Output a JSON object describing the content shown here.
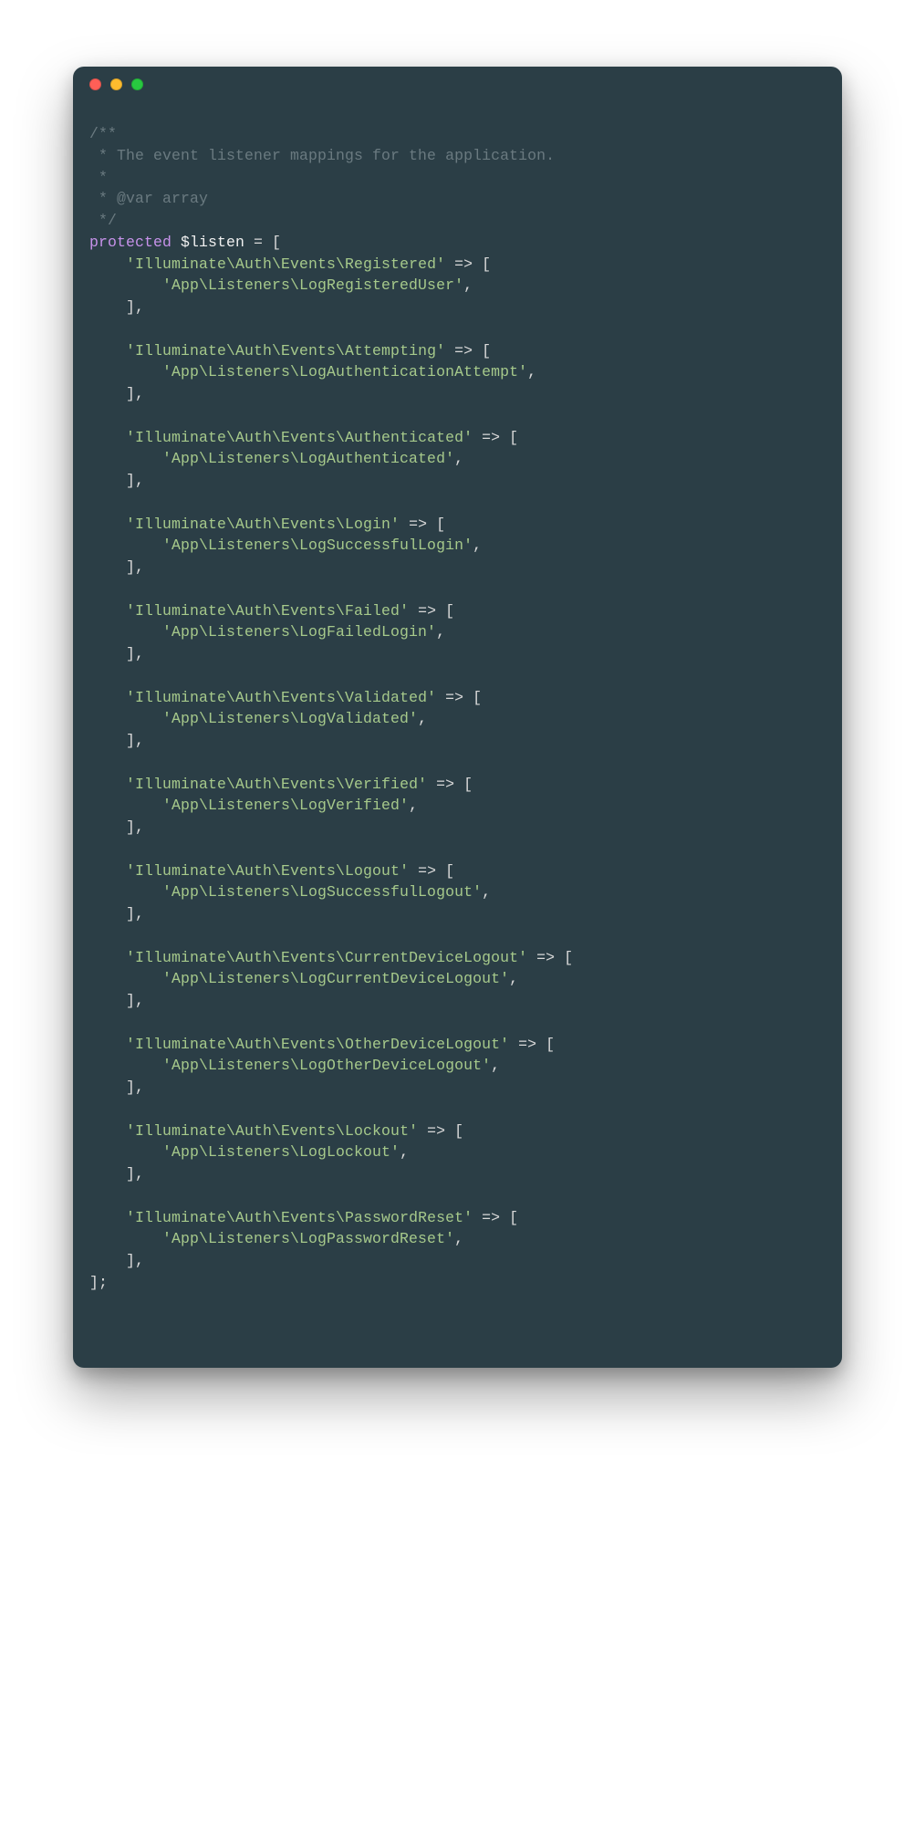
{
  "colors": {
    "window_bg": "#2b3e46",
    "comment": "#6a7a80",
    "keyword": "#c792ea",
    "variable": "#f0f0f0",
    "string": "#a6c98b",
    "punct": "#d9d9d9",
    "traffic_red": "#ff5f57",
    "traffic_yellow": "#febc2e",
    "traffic_green": "#28c840"
  },
  "doc": {
    "open": "/**",
    "line1": " * The event listener mappings for the application.",
    "blank": " *",
    "var": " * @var array",
    "close": " */"
  },
  "decl": {
    "keyword": "protected",
    "variable": "$listen",
    "assign": " = [",
    "close": "];"
  },
  "entry_punc": {
    "arrow_open": " => [",
    "listener_trail": ",",
    "block_close": "],"
  },
  "entries": [
    {
      "event": "'Illuminate\\Auth\\Events\\Registered'",
      "listener": "'App\\Listeners\\LogRegisteredUser'"
    },
    {
      "event": "'Illuminate\\Auth\\Events\\Attempting'",
      "listener": "'App\\Listeners\\LogAuthenticationAttempt'"
    },
    {
      "event": "'Illuminate\\Auth\\Events\\Authenticated'",
      "listener": "'App\\Listeners\\LogAuthenticated'"
    },
    {
      "event": "'Illuminate\\Auth\\Events\\Login'",
      "listener": "'App\\Listeners\\LogSuccessfulLogin'"
    },
    {
      "event": "'Illuminate\\Auth\\Events\\Failed'",
      "listener": "'App\\Listeners\\LogFailedLogin'"
    },
    {
      "event": "'Illuminate\\Auth\\Events\\Validated'",
      "listener": "'App\\Listeners\\LogValidated'"
    },
    {
      "event": "'Illuminate\\Auth\\Events\\Verified'",
      "listener": "'App\\Listeners\\LogVerified'"
    },
    {
      "event": "'Illuminate\\Auth\\Events\\Logout'",
      "listener": "'App\\Listeners\\LogSuccessfulLogout'"
    },
    {
      "event": "'Illuminate\\Auth\\Events\\CurrentDeviceLogout'",
      "listener": "'App\\Listeners\\LogCurrentDeviceLogout'"
    },
    {
      "event": "'Illuminate\\Auth\\Events\\OtherDeviceLogout'",
      "listener": "'App\\Listeners\\LogOtherDeviceLogout'"
    },
    {
      "event": "'Illuminate\\Auth\\Events\\Lockout'",
      "listener": "'App\\Listeners\\LogLockout'"
    },
    {
      "event": "'Illuminate\\Auth\\Events\\PasswordReset'",
      "listener": "'App\\Listeners\\LogPasswordReset'"
    }
  ]
}
